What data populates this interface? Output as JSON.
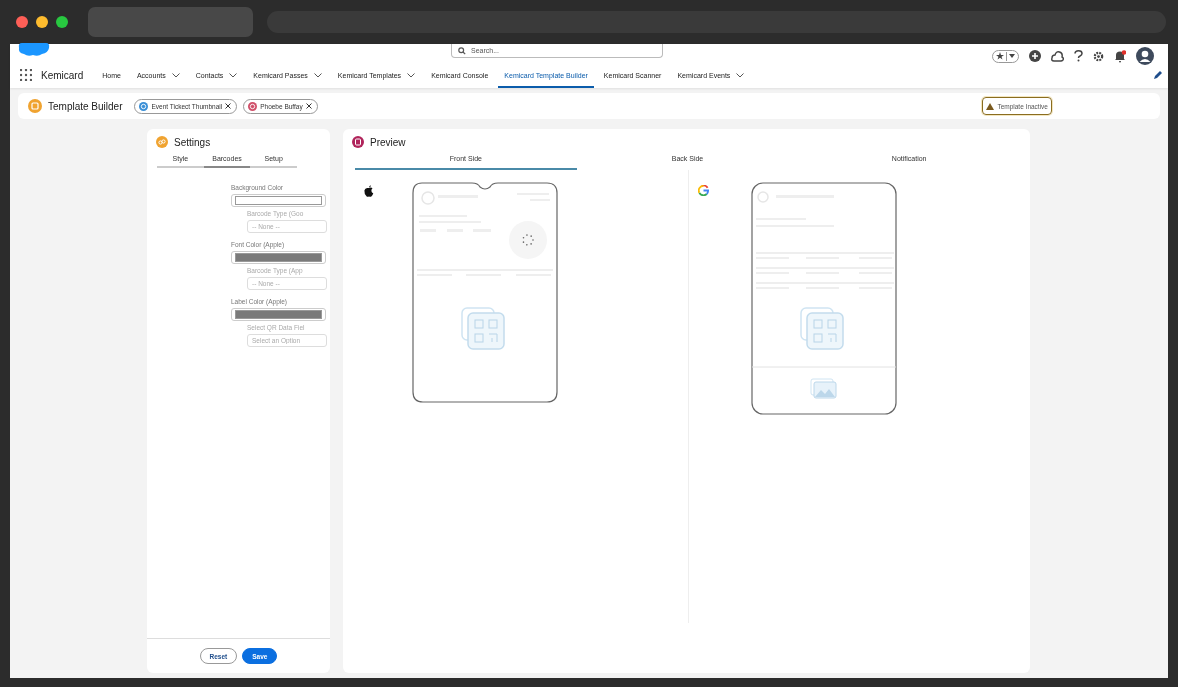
{
  "app": {
    "name": "Kemicard"
  },
  "search": {
    "placeholder": "Search..."
  },
  "nav": [
    {
      "label": "Home",
      "menu": false,
      "selected": false
    },
    {
      "label": "Accounts",
      "menu": true,
      "selected": false
    },
    {
      "label": "Contacts",
      "menu": true,
      "selected": false
    },
    {
      "label": "Kemicard Passes",
      "menu": true,
      "selected": false
    },
    {
      "label": "Kemicard Templates",
      "menu": true,
      "selected": false
    },
    {
      "label": "Kemicard Console",
      "menu": false,
      "selected": false
    },
    {
      "label": "Kemicard Template Builder",
      "menu": false,
      "selected": true
    },
    {
      "label": "Kemicard Scanner",
      "menu": false,
      "selected": false
    },
    {
      "label": "Kemicard Events",
      "menu": true,
      "selected": false
    }
  ],
  "page": {
    "title": "Template Builder",
    "chips": [
      {
        "label": "Event Tickect Thumbnail",
        "color": "#3a8fd6"
      },
      {
        "label": "Phoebe Buffay",
        "color": "#d0506a"
      }
    ],
    "status": "Template Inactive"
  },
  "settings": {
    "title": "Settings",
    "tabs": [
      {
        "label": "Style",
        "selected": false
      },
      {
        "label": "Barcodes",
        "selected": true
      },
      {
        "label": "Setup",
        "selected": false
      }
    ],
    "color_fields": [
      {
        "label": "Background Color",
        "color": "#ffffff"
      },
      {
        "label": "Font Color (Apple)",
        "color": "#7a7a7a"
      },
      {
        "label": "Label Color (Apple)",
        "color": "#7a7a7a"
      }
    ],
    "select_fields": [
      {
        "label": "Barcode Type (Goo",
        "value": "-- None --"
      },
      {
        "label": "Barcode Type (App",
        "value": "-- None --"
      },
      {
        "label": "Select QR Data Fiel",
        "placeholder": "Select an Option"
      }
    ],
    "buttons": [
      {
        "label": "Reset",
        "kind": "neutral"
      },
      {
        "label": "Save",
        "kind": "brand"
      }
    ]
  },
  "preview": {
    "title": "Preview",
    "tabs": [
      {
        "label": "Front Side",
        "selected": true
      },
      {
        "label": "Back Side",
        "selected": false
      },
      {
        "label": "Notification",
        "selected": false
      }
    ],
    "cards": [
      {
        "kind": "apple"
      },
      {
        "kind": "google"
      }
    ]
  }
}
